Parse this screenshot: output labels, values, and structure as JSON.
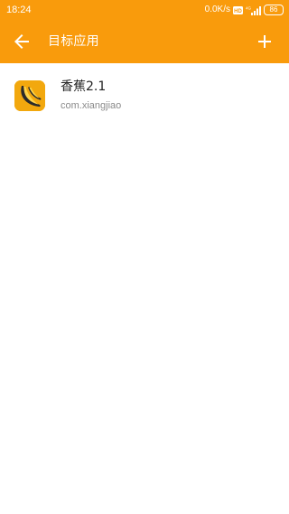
{
  "status_bar": {
    "time": "18:24",
    "net_speed": "0.0K/s",
    "hd_badge": "HD",
    "signal_badge": "4G",
    "battery": "86"
  },
  "app_bar": {
    "title": "目标应用",
    "back_icon": "arrow-left-icon",
    "add_icon": "plus-icon"
  },
  "apps": [
    {
      "name": "香蕉2.1",
      "package": "com.xiangjiao",
      "icon": "banana-icon"
    }
  ],
  "colors": {
    "accent": "#f99b0c",
    "icon_bg": "#f2a80e",
    "text_primary": "#222222",
    "text_secondary": "#8a8a8a"
  }
}
